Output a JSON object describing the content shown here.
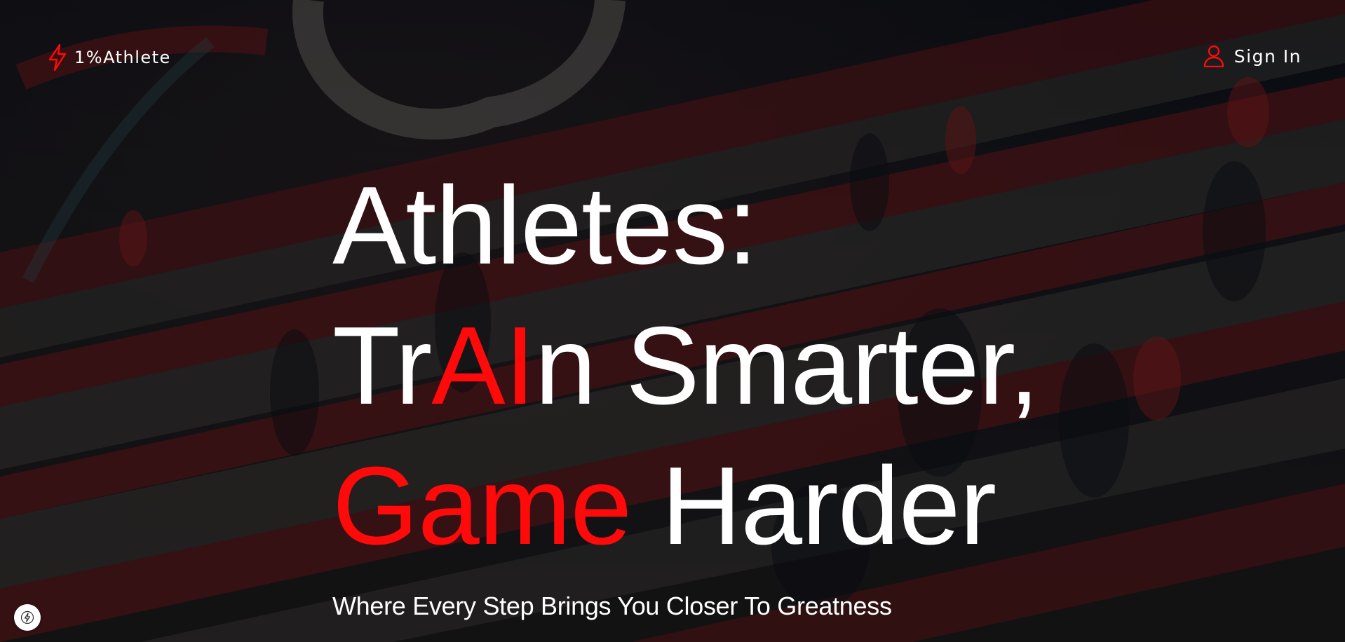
{
  "nav": {
    "brand_icon": "lightning-bolt-icon",
    "brand_name": "1%Athlete",
    "signin_icon": "user-icon",
    "signin_label": "Sign In"
  },
  "hero": {
    "line1": "Athletes:",
    "line2_part1": "Tr",
    "line2_part2": "AI",
    "line2_part3": "n Smarter,",
    "line3_part1": "Game",
    "line3_part2": " Harder",
    "subtitle": "Where Every Step Brings You Closer To Greatness"
  },
  "floating_badge": {
    "icon": "lightning-bolt-icon"
  },
  "colors": {
    "accent": "#ff0a0a",
    "text": "#ffffff",
    "background": "#0b0f14"
  }
}
